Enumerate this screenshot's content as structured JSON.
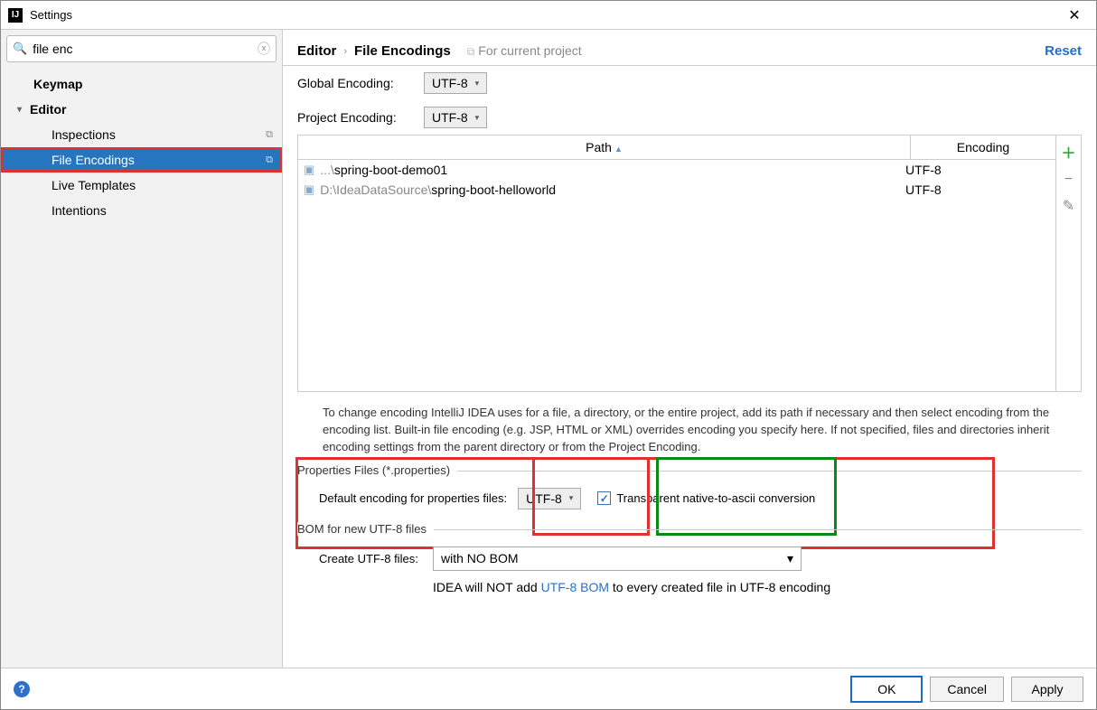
{
  "window": {
    "title": "Settings"
  },
  "search": {
    "value": "file enc"
  },
  "sidebar": {
    "items": [
      {
        "label": "Keymap",
        "type": "section"
      },
      {
        "label": "Editor",
        "type": "expandable"
      },
      {
        "label": "Inspections",
        "type": "child",
        "badge": true
      },
      {
        "label": "File Encodings",
        "type": "child",
        "selected": true,
        "badge": true
      },
      {
        "label": "Live Templates",
        "type": "child"
      },
      {
        "label": "Intentions",
        "type": "child"
      }
    ]
  },
  "breadcrumb": {
    "parent": "Editor",
    "current": "File Encodings",
    "context": "For current project",
    "reset": "Reset"
  },
  "encodings": {
    "global_label": "Global Encoding:",
    "global_value": "UTF-8",
    "project_label": "Project Encoding:",
    "project_value": "UTF-8"
  },
  "table": {
    "headers": {
      "path": "Path",
      "encoding": "Encoding"
    },
    "rows": [
      {
        "prefix": "...\\",
        "name": "spring-boot-demo01",
        "encoding": "UTF-8"
      },
      {
        "prefix": "D:\\IdeaDataSource\\",
        "name": "spring-boot-helloworld",
        "encoding": "UTF-8"
      }
    ]
  },
  "help": "To change encoding IntelliJ IDEA uses for a file, a directory, or the entire project, add its path if necessary and then select encoding from the encoding list. Built-in file encoding (e.g. JSP, HTML or XML) overrides encoding you specify here. If not specified, files and directories inherit encoding settings from the parent directory or from the Project Encoding.",
  "properties": {
    "legend": "Properties Files (*.properties)",
    "default_label": "Default encoding for properties files:",
    "default_value": "UTF-8",
    "transparent_label": "Transparent native-to-ascii conversion",
    "transparent_checked": true
  },
  "bom": {
    "legend": "BOM for new UTF-8 files",
    "create_label": "Create UTF-8 files:",
    "create_value": "with NO BOM",
    "note_pre": "IDEA will NOT add ",
    "note_link": "UTF-8 BOM",
    "note_post": " to every created file in UTF-8 encoding"
  },
  "footer": {
    "ok": "OK",
    "cancel": "Cancel",
    "apply": "Apply"
  }
}
